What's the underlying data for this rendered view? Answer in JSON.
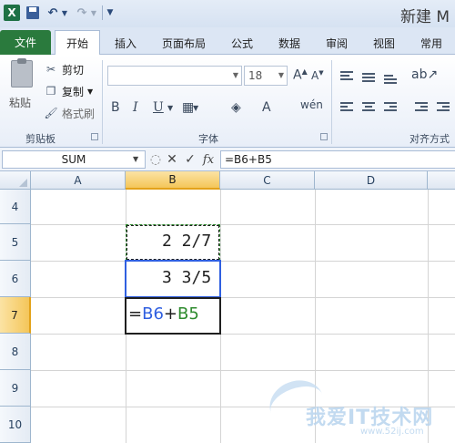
{
  "titlebar": {
    "app_logo": "X",
    "title": "新建 M",
    "icons": [
      "excel-logo-icon",
      "save-icon",
      "undo-icon",
      "redo-icon",
      "customize-icon"
    ]
  },
  "tabs": [
    {
      "label": "文件"
    },
    {
      "label": "开始"
    },
    {
      "label": "插入"
    },
    {
      "label": "页面布局"
    },
    {
      "label": "公式"
    },
    {
      "label": "数据"
    },
    {
      "label": "审阅"
    },
    {
      "label": "视图"
    },
    {
      "label": "常用"
    }
  ],
  "ribbon": {
    "clipboard": {
      "paste_label": "粘贴",
      "cut_label": "剪切",
      "copy_label": "复制",
      "format_painter_label": "格式刷",
      "group_label": "剪贴板"
    },
    "font": {
      "font_name": "",
      "font_size": "18",
      "group_label": "字体"
    },
    "alignment": {
      "group_label": "对齐方式"
    }
  },
  "formula_bar": {
    "name_box": "SUM",
    "cancel_glyph": "✕",
    "enter_glyph": "✓",
    "fx_label": "fx",
    "formula": "=B6+B5"
  },
  "grid": {
    "columns": [
      "A",
      "B",
      "C",
      "D"
    ],
    "rows": [
      "4",
      "5",
      "6",
      "7",
      "8",
      "9",
      "10"
    ],
    "cells": {
      "B5": "2 2/7",
      "B6": "3 3/5"
    },
    "editing_cell": {
      "address": "B7",
      "tokens": [
        {
          "text": "=",
          "color": "plain"
        },
        {
          "text": "B6",
          "color": "blue"
        },
        {
          "text": "+",
          "color": "plain"
        },
        {
          "text": "B5",
          "color": "green"
        }
      ]
    }
  },
  "colors": {
    "ref_b6": "#2f5fe0",
    "ref_b5": "#2e8b2e",
    "selected_header": "#f4c65a"
  },
  "watermark": {
    "text": "我爱IT技术网",
    "url": "www.52ij.com"
  }
}
